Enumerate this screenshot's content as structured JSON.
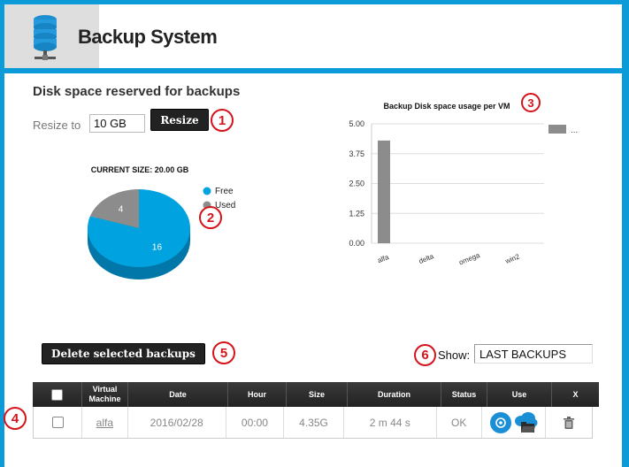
{
  "app": {
    "title": "Backup System"
  },
  "disk": {
    "title": "Disk space reserved for backups",
    "resize_label": "Resize to",
    "resize_value": "10 GB",
    "resize_button": "Resize"
  },
  "badges": [
    "1",
    "2",
    "3",
    "4",
    "5",
    "6"
  ],
  "chart_data": [
    {
      "type": "pie",
      "title": "CURRENT SIZE: 20.00 GB",
      "slices": [
        {
          "label": "Free",
          "value": 16,
          "color": "#00a3df"
        },
        {
          "label": "Used",
          "value": 4,
          "color": "#8c8c8c"
        }
      ],
      "legend": "right"
    },
    {
      "type": "bar",
      "title": "Backup Disk space usage per VM",
      "categories": [
        "alfa",
        "delta",
        "omega",
        "win2"
      ],
      "values": [
        4.3,
        0,
        0,
        0
      ],
      "yticks": [
        "0.00",
        "1.25",
        "2.50",
        "3.75",
        "5.00"
      ],
      "ylim": [
        0,
        5
      ],
      "grid": true,
      "legend": "top-right",
      "legend_label": "...",
      "color": "#8c8c8c"
    }
  ],
  "actions": {
    "delete_button": "Delete selected backups",
    "show_label": "Show:",
    "show_value": "LAST BACKUPS"
  },
  "table": {
    "headers": [
      "",
      "Virtual Machine",
      "Date",
      "Hour",
      "Size",
      "Duration",
      "Status",
      "Use",
      "X"
    ],
    "rows": [
      {
        "vm": "alfa",
        "date": "2016/02/28",
        "hour": "00:00",
        "size": "4.35G",
        "duration": "2 m 44 s",
        "status": "OK"
      }
    ]
  },
  "colors": {
    "accent": "#0a9bd8",
    "badge": "#d4141a"
  },
  "icons": [
    "database-icon",
    "disc-icon",
    "cloud-folder-icon",
    "trash-icon"
  ]
}
